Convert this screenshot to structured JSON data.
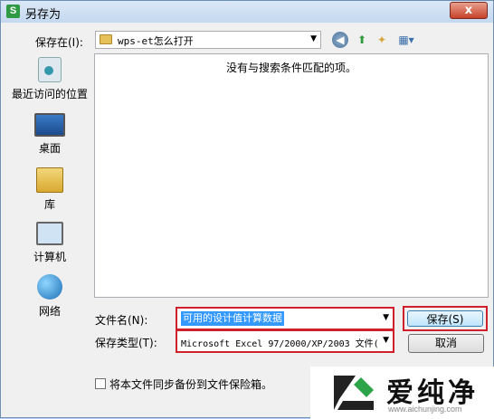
{
  "window": {
    "title": "另存为",
    "app_icon_text": "S",
    "close_label": "x"
  },
  "toolbar": {
    "save_in_label": "保存在(I):",
    "location": "wps-et怎么打开",
    "back_icon": "back-icon",
    "up_icon": "up-folder-icon",
    "new_folder_icon": "new-folder-icon",
    "view_icon": "view-menu-icon"
  },
  "places": [
    {
      "label": "最近访问的位置",
      "icon": "recent-places-icon"
    },
    {
      "label": "桌面",
      "icon": "desktop-icon"
    },
    {
      "label": "库",
      "icon": "library-icon"
    },
    {
      "label": "计算机",
      "icon": "computer-icon"
    },
    {
      "label": "网络",
      "icon": "network-icon"
    }
  ],
  "file_list": {
    "empty_message": "没有与搜索条件匹配的项。"
  },
  "form": {
    "filename_label": "文件名(N):",
    "filename_value": "可用的设计值计算数据",
    "filetype_label": "保存类型(T):",
    "filetype_value": "Microsoft Excel 97/2000/XP/2003 文件(",
    "save_label": "保存(S)",
    "cancel_label": "取消",
    "backup_label": "将本文件同步备份到文件保险箱。"
  },
  "watermark": {
    "text": "爱纯净",
    "url": "www.aichunjing.com"
  },
  "colors": {
    "highlight": "#d0202c",
    "selection": "#3399ff"
  }
}
